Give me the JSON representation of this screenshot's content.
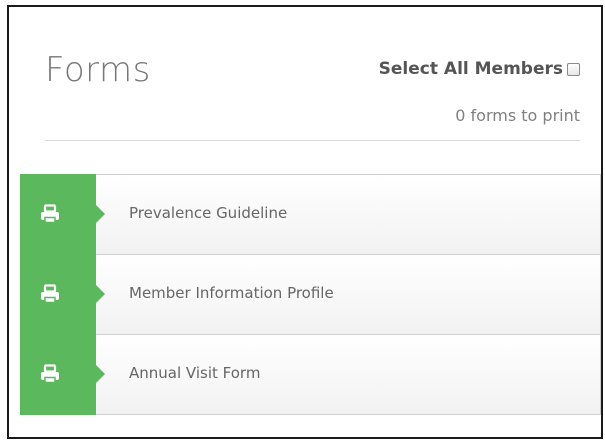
{
  "header": {
    "title": "Forms",
    "select_all_label": "Select All Members",
    "select_all_checked": false,
    "forms_count_text": "0 forms to print"
  },
  "forms": [
    {
      "label": "Prevalence Guideline",
      "icon": "printer-icon"
    },
    {
      "label": "Member Information Profile",
      "icon": "printer-icon"
    },
    {
      "label": "Annual Visit Form",
      "icon": "printer-icon"
    }
  ],
  "colors": {
    "accent": "#5cb85c",
    "title_text": "#777777",
    "row_text": "#666666",
    "frame_border": "#1a1a1a"
  }
}
